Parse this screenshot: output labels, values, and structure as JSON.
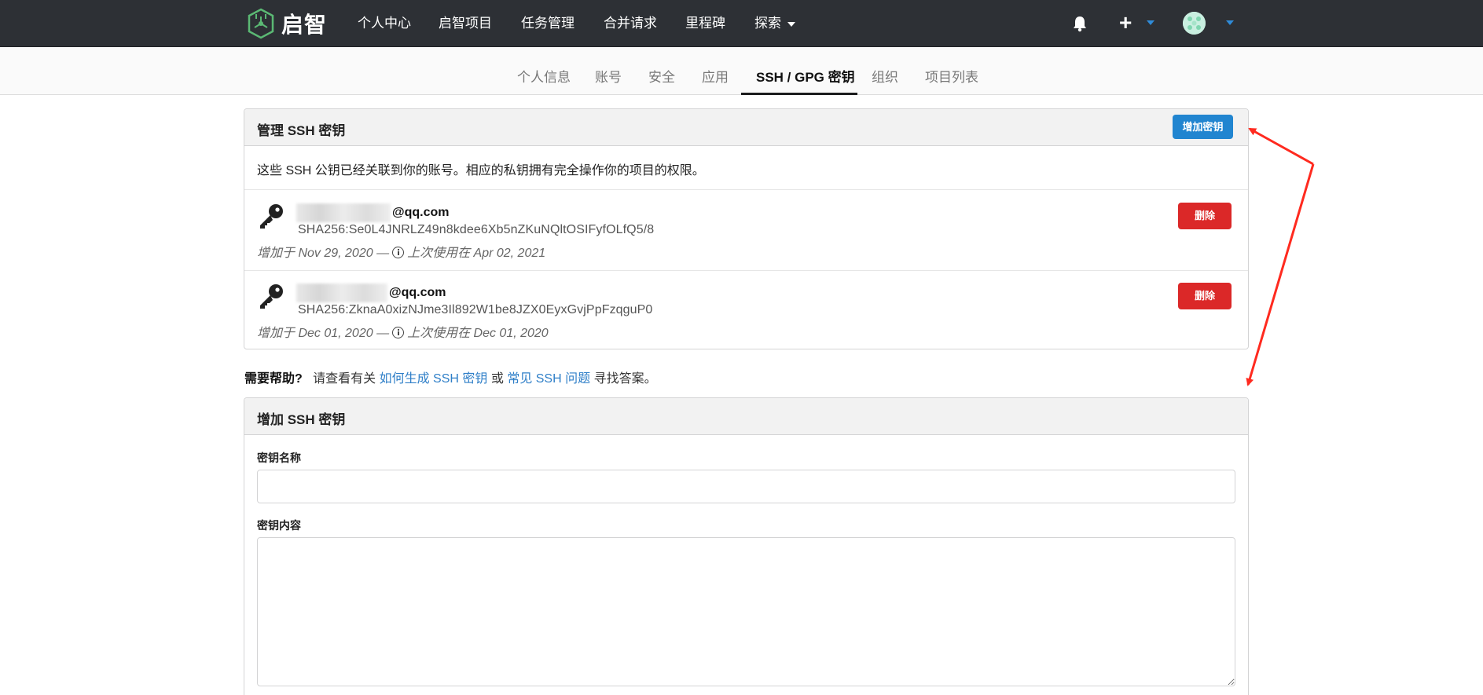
{
  "brand": {
    "name": "启智"
  },
  "nav": {
    "items": [
      "个人中心",
      "启智项目",
      "任务管理",
      "合并请求",
      "里程碑"
    ],
    "explore": "探索"
  },
  "tabs": [
    {
      "label": "个人信息"
    },
    {
      "label": "账号"
    },
    {
      "label": "安全"
    },
    {
      "label": "应用"
    },
    {
      "label": "SSH / GPG 密钥",
      "active": true
    },
    {
      "label": "组织"
    },
    {
      "label": "项目列表"
    }
  ],
  "manage": {
    "title": "管理 SSH 密钥",
    "add_button": "增加密钥",
    "description": "这些 SSH 公钥已经关联到你的账号。相应的私钥拥有完全操作你的项目的权限。",
    "keys": [
      {
        "name_suffix": "@qq.com",
        "fingerprint": "SHA256:Se0L4JNRLZ49n8kdee6Xb5nZKuNQltOSIFyfOLfQ5/8",
        "added": "增加于 Nov 29, 2020 —",
        "last_used": "上次使用在 Apr 02, 2021",
        "delete_label": "删除"
      },
      {
        "name_suffix": "@qq.com",
        "fingerprint": "SHA256:ZknaA0xizNJme3Il892W1be8JZX0EyxGvjPpFzqguP0",
        "added": "增加于 Dec 01, 2020 —",
        "last_used": "上次使用在 Dec 01, 2020",
        "delete_label": "删除"
      }
    ]
  },
  "help": {
    "lead": "需要帮助?",
    "text1": "请查看有关",
    "link1": "如何生成 SSH 密钥",
    "or": "或",
    "link2": "常见 SSH 问题",
    "text2": "寻找答案。"
  },
  "add_form": {
    "title": "增加 SSH 密钥",
    "name_label": "密钥名称",
    "name_value": "",
    "content_label": "密钥内容",
    "content_value": ""
  },
  "colors": {
    "navbar": "#2d3035",
    "primary": "#2185d0",
    "danger": "#db2828",
    "link": "#2f7fc8",
    "annotation_arrow": "#ff2a1f"
  },
  "icons": [
    "brand-logo-icon",
    "caret-down-icon",
    "bell-icon",
    "plus-icon",
    "avatar",
    "key-icon",
    "info-icon"
  ]
}
